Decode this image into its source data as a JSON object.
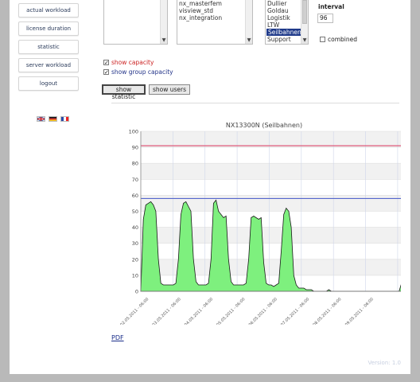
{
  "sidebar": {
    "items": [
      {
        "label": "actual workload"
      },
      {
        "label": "license duration"
      },
      {
        "label": "statistic"
      },
      {
        "label": "server workload"
      },
      {
        "label": "logout"
      }
    ],
    "languages": [
      "english",
      "german",
      "french"
    ]
  },
  "filters": {
    "list1": {
      "items": []
    },
    "list2": {
      "items": [
        "nx_masterfem",
        "visview_std",
        "nx_integration"
      ]
    },
    "list3": {
      "items": [
        "Dullier",
        "Goldau",
        "Logistik",
        "LTW",
        "Seilbahnen",
        "Support"
      ],
      "selected": "Seilbahnen"
    },
    "interval_label": "interval",
    "interval_value": "96",
    "combined_label": "combined",
    "combined_checked": false
  },
  "options": {
    "show_capacity_label": "show capacity",
    "show_capacity_checked": true,
    "show_group_capacity_label": "show group capacity",
    "show_group_capacity_checked": true
  },
  "buttons": {
    "show_statistic": "show statistic",
    "show_users": "show users"
  },
  "colors": {
    "area_fill": "#7ef07e",
    "capacity_line": "#e05a7a",
    "group_capacity_line": "#5566cc",
    "capacity_label": "#cc2222",
    "group_capacity_label": "#223388",
    "link": "#1a2e8a"
  },
  "chart_data": {
    "type": "area",
    "title": "NX13300N (Seilbahnen)",
    "ylim": [
      0,
      100
    ],
    "yticks": [
      0,
      10,
      20,
      30,
      40,
      50,
      60,
      70,
      80,
      90,
      100
    ],
    "capacity": 91,
    "group_capacity": 58,
    "grid": true,
    "x_labels": [
      "02.05.2011 - 06:00",
      "03.05.2011 - 06:00",
      "04.05.2011 - 06:00",
      "05.05.2011 - 06:00",
      "06.05.2011 - 06:00",
      "07.05.2011 - 06:00",
      "08.05.2011 - 06:00",
      "09.05.2011 - 06:00"
    ],
    "series": [
      {
        "values": [
          0,
          45,
          54,
          55,
          56,
          54,
          50,
          20,
          5,
          4,
          4,
          4,
          4,
          4,
          5,
          20,
          48,
          55,
          56,
          53,
          50,
          20,
          6,
          4,
          4,
          4,
          4,
          5,
          20,
          55,
          57,
          50,
          48,
          46,
          47,
          20,
          6,
          4,
          4,
          4,
          4,
          4,
          5,
          20,
          46,
          47,
          46,
          45,
          46,
          18,
          5,
          4,
          4,
          3,
          4,
          5,
          25,
          48,
          52,
          50,
          40,
          10,
          4,
          2,
          2,
          2,
          1,
          1,
          1,
          0,
          0,
          0,
          0,
          0,
          0,
          1,
          0,
          0,
          0,
          0,
          0,
          0,
          0,
          0,
          0,
          0,
          0,
          0,
          0,
          0,
          0,
          0,
          0,
          0,
          0,
          0,
          0,
          0,
          0,
          0,
          0,
          0,
          0,
          0,
          5,
          38
        ]
      }
    ]
  },
  "pdf_link": "PDF",
  "footer": "Version: 1.0"
}
